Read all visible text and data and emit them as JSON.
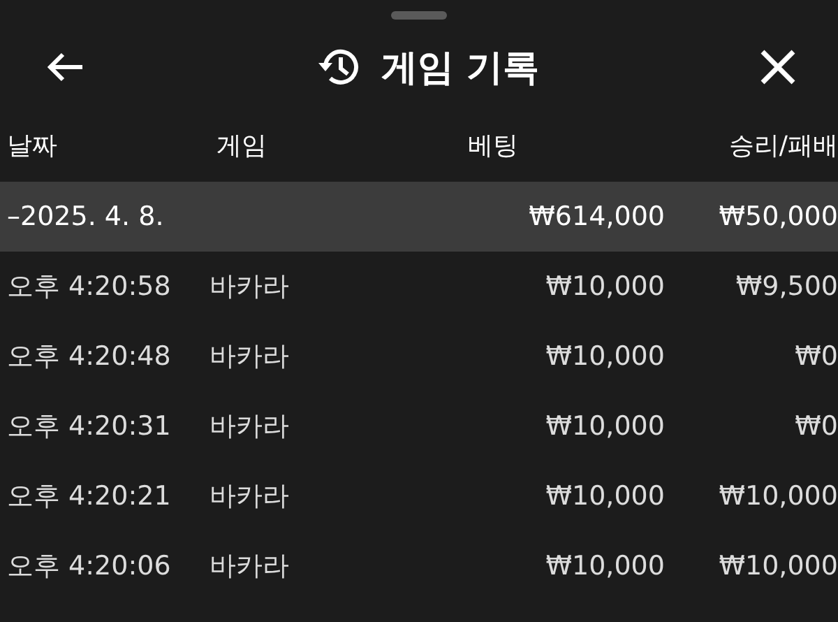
{
  "header": {
    "title": "게임 기록"
  },
  "table": {
    "columns": [
      "날짜",
      "게임",
      "베팅",
      "승리/패배"
    ],
    "group": {
      "date": "–2025. 4. 8.",
      "bet": "₩614,000",
      "result": "₩50,000"
    },
    "rows": [
      {
        "time": "오후 4:20:58",
        "game": "바카라",
        "bet": "₩10,000",
        "result": "₩9,500"
      },
      {
        "time": "오후 4:20:48",
        "game": "바카라",
        "bet": "₩10,000",
        "result": "₩0"
      },
      {
        "time": "오후 4:20:31",
        "game": "바카라",
        "bet": "₩10,000",
        "result": "₩0"
      },
      {
        "time": "오후 4:20:21",
        "game": "바카라",
        "bet": "₩10,000",
        "result": "₩10,000"
      },
      {
        "time": "오후 4:20:06",
        "game": "바카라",
        "bet": "₩10,000",
        "result": "₩10,000"
      }
    ]
  }
}
